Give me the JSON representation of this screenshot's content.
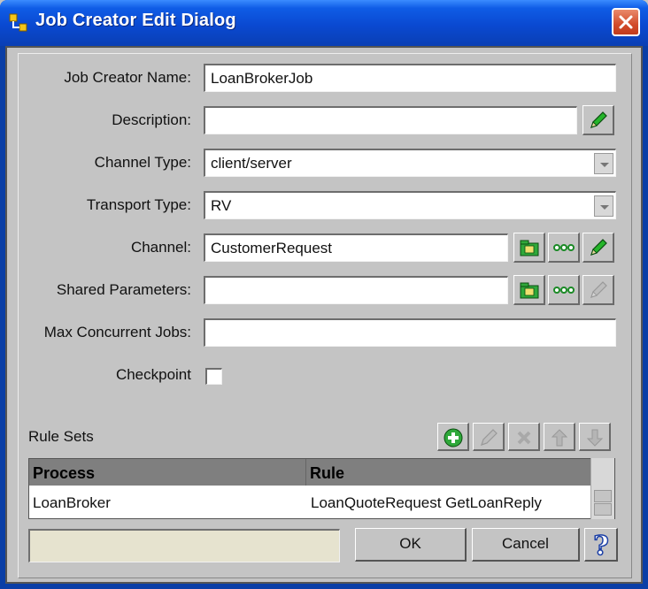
{
  "window": {
    "title": "Job Creator Edit Dialog"
  },
  "form": {
    "name_label": "Job Creator Name:",
    "name_value": "LoanBrokerJob",
    "description_label": "Description:",
    "description_value": "",
    "channel_type_label": "Channel Type:",
    "channel_type_value": "client/server",
    "transport_type_label": "Transport Type:",
    "transport_type_value": "RV",
    "channel_label": "Channel:",
    "channel_value": "CustomerRequest",
    "shared_params_label": "Shared Parameters:",
    "shared_params_value": "",
    "max_jobs_label": "Max Concurrent Jobs:",
    "max_jobs_value": "",
    "checkpoint_label": "Checkpoint",
    "checkpoint_checked": false
  },
  "rule_sets": {
    "label": "Rule Sets",
    "columns": [
      "Process",
      "Rule"
    ],
    "rows": [
      {
        "process": "LoanBroker",
        "rule": "LoanQuoteRequest GetLoanReply"
      }
    ]
  },
  "buttons": {
    "ok": "OK",
    "cancel": "Cancel"
  },
  "colors": {
    "title_bar": "#0a49d1",
    "window_bg": "#c4c4c4",
    "table_header": "#7f7f7f",
    "status_panel": "#e6e3cf"
  }
}
